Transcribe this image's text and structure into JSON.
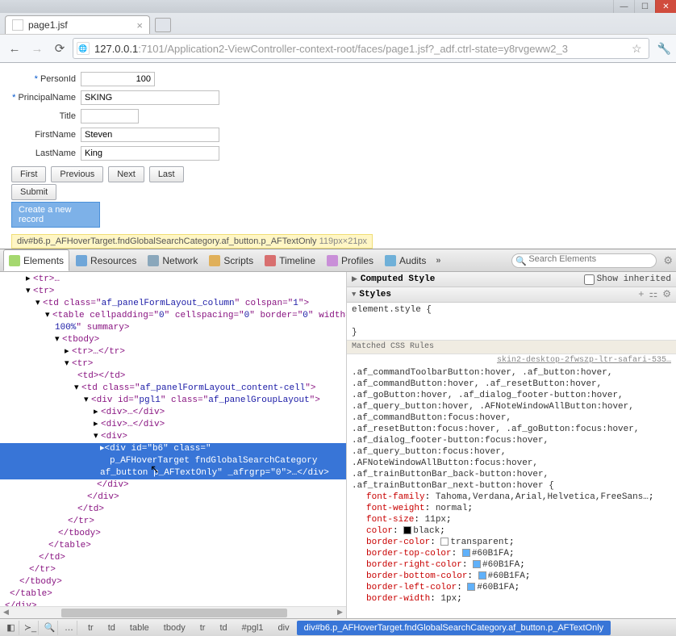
{
  "window": {
    "tab_title": "page1.jsf",
    "url_host": "127.0.0.1",
    "url_port": ":7101",
    "url_path": "/Application2-ViewController-context-root/faces/page1.jsf?_adf.ctrl-state=y8rvgeww2_3"
  },
  "form": {
    "person_id": {
      "label": "PersonId",
      "value": "100"
    },
    "principal_name": {
      "label": "PrincipalName",
      "value": "SKING"
    },
    "title": {
      "label": "Title",
      "value": ""
    },
    "first_name": {
      "label": "FirstName",
      "value": "Steven"
    },
    "last_name": {
      "label": "LastName",
      "value": "King"
    }
  },
  "buttons": {
    "first": "First",
    "previous": "Previous",
    "next": "Next",
    "last": "Last",
    "submit": "Submit",
    "create": "Create a new record"
  },
  "highlight": {
    "selector": "div#b6.p_AFHoverTarget.fndGlobalSearchCategory.af_button.p_AFTextOnly",
    "dimensions": "119px×21px"
  },
  "devtools": {
    "tabs": {
      "elements": "Elements",
      "resources": "Resources",
      "network": "Network",
      "scripts": "Scripts",
      "timeline": "Timeline",
      "profiles": "Profiles",
      "audits": "Audits"
    },
    "search_placeholder": "Search Elements",
    "dom": {
      "l0": "<tr>…",
      "l1": "<tr>",
      "l2a": "<td class=\"",
      "l2b": "af_panelFormLayout_column",
      "l2c": "\" colspan=\"",
      "l2d": "1",
      "l2e": "\">",
      "l3a": "<table cellpadding=\"",
      "l3b": "0",
      "l3c": "\" cellspacing=\"",
      "l3d": "\" border=\"",
      "l3e": "\" width=\"",
      "l3f": "100%",
      "l3g": "\" summary>",
      "l4": "<tbody>",
      "l5": "<tr>…</tr>",
      "l6": "<tr>",
      "l7": "<td></td>",
      "l8a": "<td class=\"",
      "l8b": "af_panelFormLayout_content-cell",
      "l8c": "\">",
      "l9a": "<div id=\"",
      "l9b": "pgl1",
      "l9c": "\" class=\"",
      "l9d": "af_panelGroupLayout",
      "l9e": "\">",
      "l10": "<div>…</div>",
      "l11": "<div>",
      "sel_a": "<div id=\"",
      "sel_b": "b6",
      "sel_c": "\" class=\"",
      "sel_d": "p_AFHoverTarget fndGlobalSearchCategory af_button p_AFTextOnly",
      "sel_e": "\" _afrgrp=\"",
      "sel_f": "0",
      "sel_g": "\">…</div>",
      "c_div": "</div>",
      "c_td": "</td>",
      "c_tr": "</tr>",
      "c_tbody": "</tbody>",
      "c_table": "</table>"
    },
    "styles": {
      "computed_header": "Computed Style",
      "show_inherited": "Show inherited",
      "styles_header": "Styles",
      "element_style": "element.style {",
      "matched_header": "Matched CSS Rules",
      "css_file": "skin2-desktop-2fwszp-ltr-safari-535…",
      "selectors": [
        ".af_commandToolbarButton:hover, .af_button:hover,",
        ".af_commandButton:hover, .af_resetButton:hover,",
        ".af_goButton:hover, .af_dialog_footer-button:hover,",
        ".af_query_button:hover, .AFNoteWindowAllButton:hover,",
        ".af_commandButton:focus:hover,",
        ".af_resetButton:focus:hover, .af_goButton:focus:hover,",
        ".af_dialog_footer-button:focus:hover,",
        ".af_query_button:focus:hover,",
        ".AFNoteWindowAllButton:focus:hover,",
        ".af_trainButtonBar_back-button:hover,",
        ".af_trainButtonBar_next-button:hover {"
      ],
      "decls": [
        {
          "prop": "font-family",
          "val": "Tahoma,Verdana,Arial,Helvetica,FreeSans…"
        },
        {
          "prop": "font-weight",
          "val": "normal"
        },
        {
          "prop": "font-size",
          "val": "11px"
        },
        {
          "prop": "color",
          "val": "black",
          "swatch": "#000000"
        },
        {
          "prop": "border-color",
          "val": "transparent",
          "swatch": "#ffffff"
        },
        {
          "prop": "border-top-color",
          "val": "#60B1FA",
          "swatch": "#60B1FA"
        },
        {
          "prop": "border-right-color",
          "val": "#60B1FA",
          "swatch": "#60B1FA"
        },
        {
          "prop": "border-bottom-color",
          "val": "#60B1FA",
          "swatch": "#60B1FA"
        },
        {
          "prop": "border-left-color",
          "val": "#60B1FA",
          "swatch": "#60B1FA"
        },
        {
          "prop": "border-width",
          "val": "1px"
        }
      ]
    },
    "breadcrumbs": [
      "tr",
      "td",
      "table",
      "tbody",
      "tr",
      "td",
      "#pgl1",
      "div"
    ],
    "breadcrumb_active": "div#b6.p_AFHoverTarget.fndGlobalSearchCategory.af_button.p_AFTextOnly"
  }
}
